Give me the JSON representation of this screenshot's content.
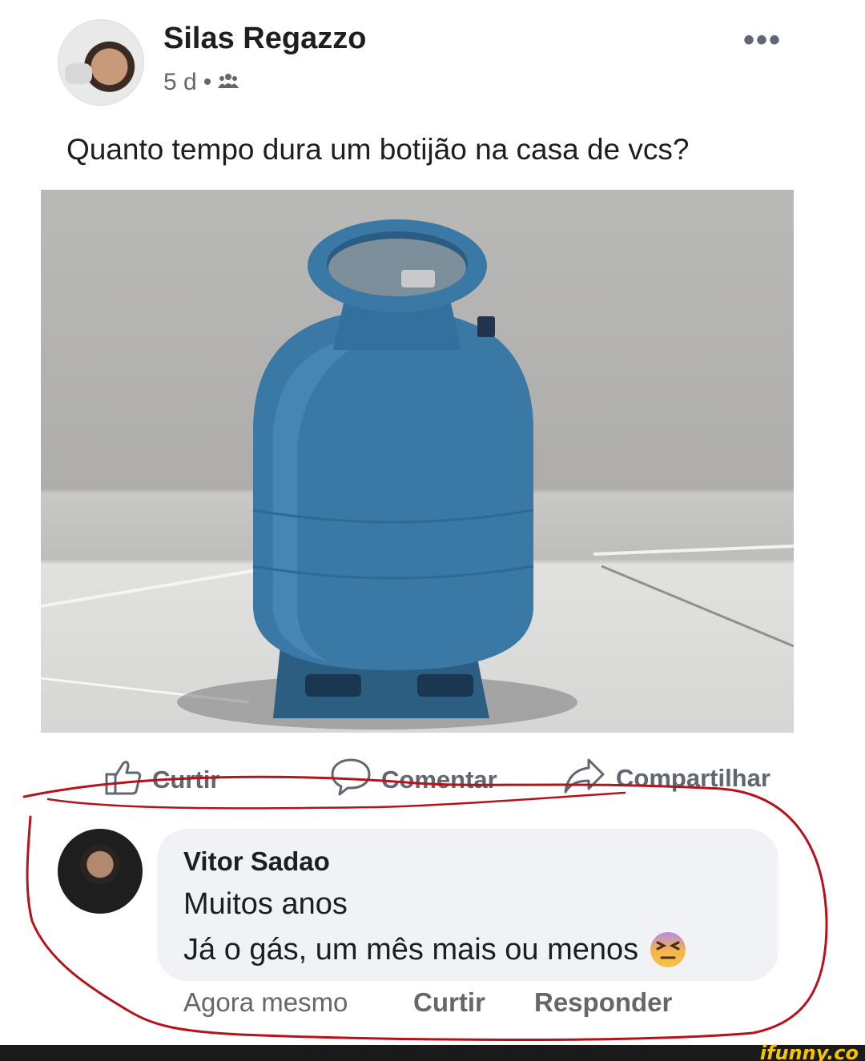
{
  "post": {
    "author": "Silas Regazzo",
    "time": "5 d",
    "separator": "•",
    "audience_icon": "friends-icon",
    "more_icon": "•••",
    "text": "Quanto tempo dura um botijão na casa de vcs?",
    "image": "blue-gas-cylinder-photo"
  },
  "actions": {
    "like": "Curtir",
    "comment": "Comentar",
    "share": "Compartilhar"
  },
  "comment": {
    "author": "Vitor Sadao",
    "line1": "Muitos anos",
    "line2": "Já o gás, um mês mais ou menos",
    "emoji": "dizzy-face-emoji",
    "time": "Agora mesmo",
    "like": "Curtir",
    "reply": "Responder"
  },
  "colors": {
    "highlight_stroke": "#b5121b",
    "bubble": "#f0f2f5",
    "secondary_text": "#65676b",
    "watermark": "#f5c400"
  },
  "watermark": "ifunny.co"
}
